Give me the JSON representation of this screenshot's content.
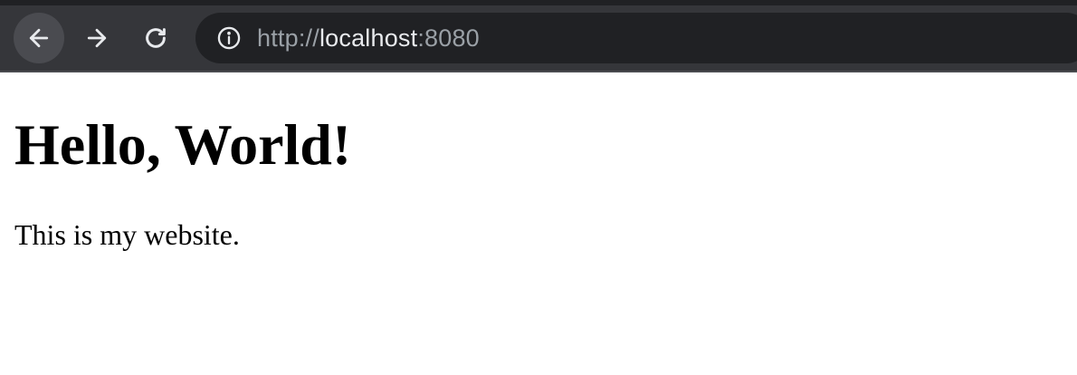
{
  "browser": {
    "address_bar": {
      "scheme": "http://",
      "host": "localhost",
      "port": ":8080"
    },
    "icons": {
      "back": "arrow-left-icon",
      "forward": "arrow-right-icon",
      "reload": "reload-icon",
      "site_info": "info-icon"
    },
    "colors": {
      "toolbar": "#35363a",
      "omnibox": "#202124",
      "url_dim": "#9aa0a6",
      "url_bright": "#e8eaed"
    }
  },
  "page": {
    "heading": "Hello, World!",
    "paragraph": "This is my website."
  }
}
